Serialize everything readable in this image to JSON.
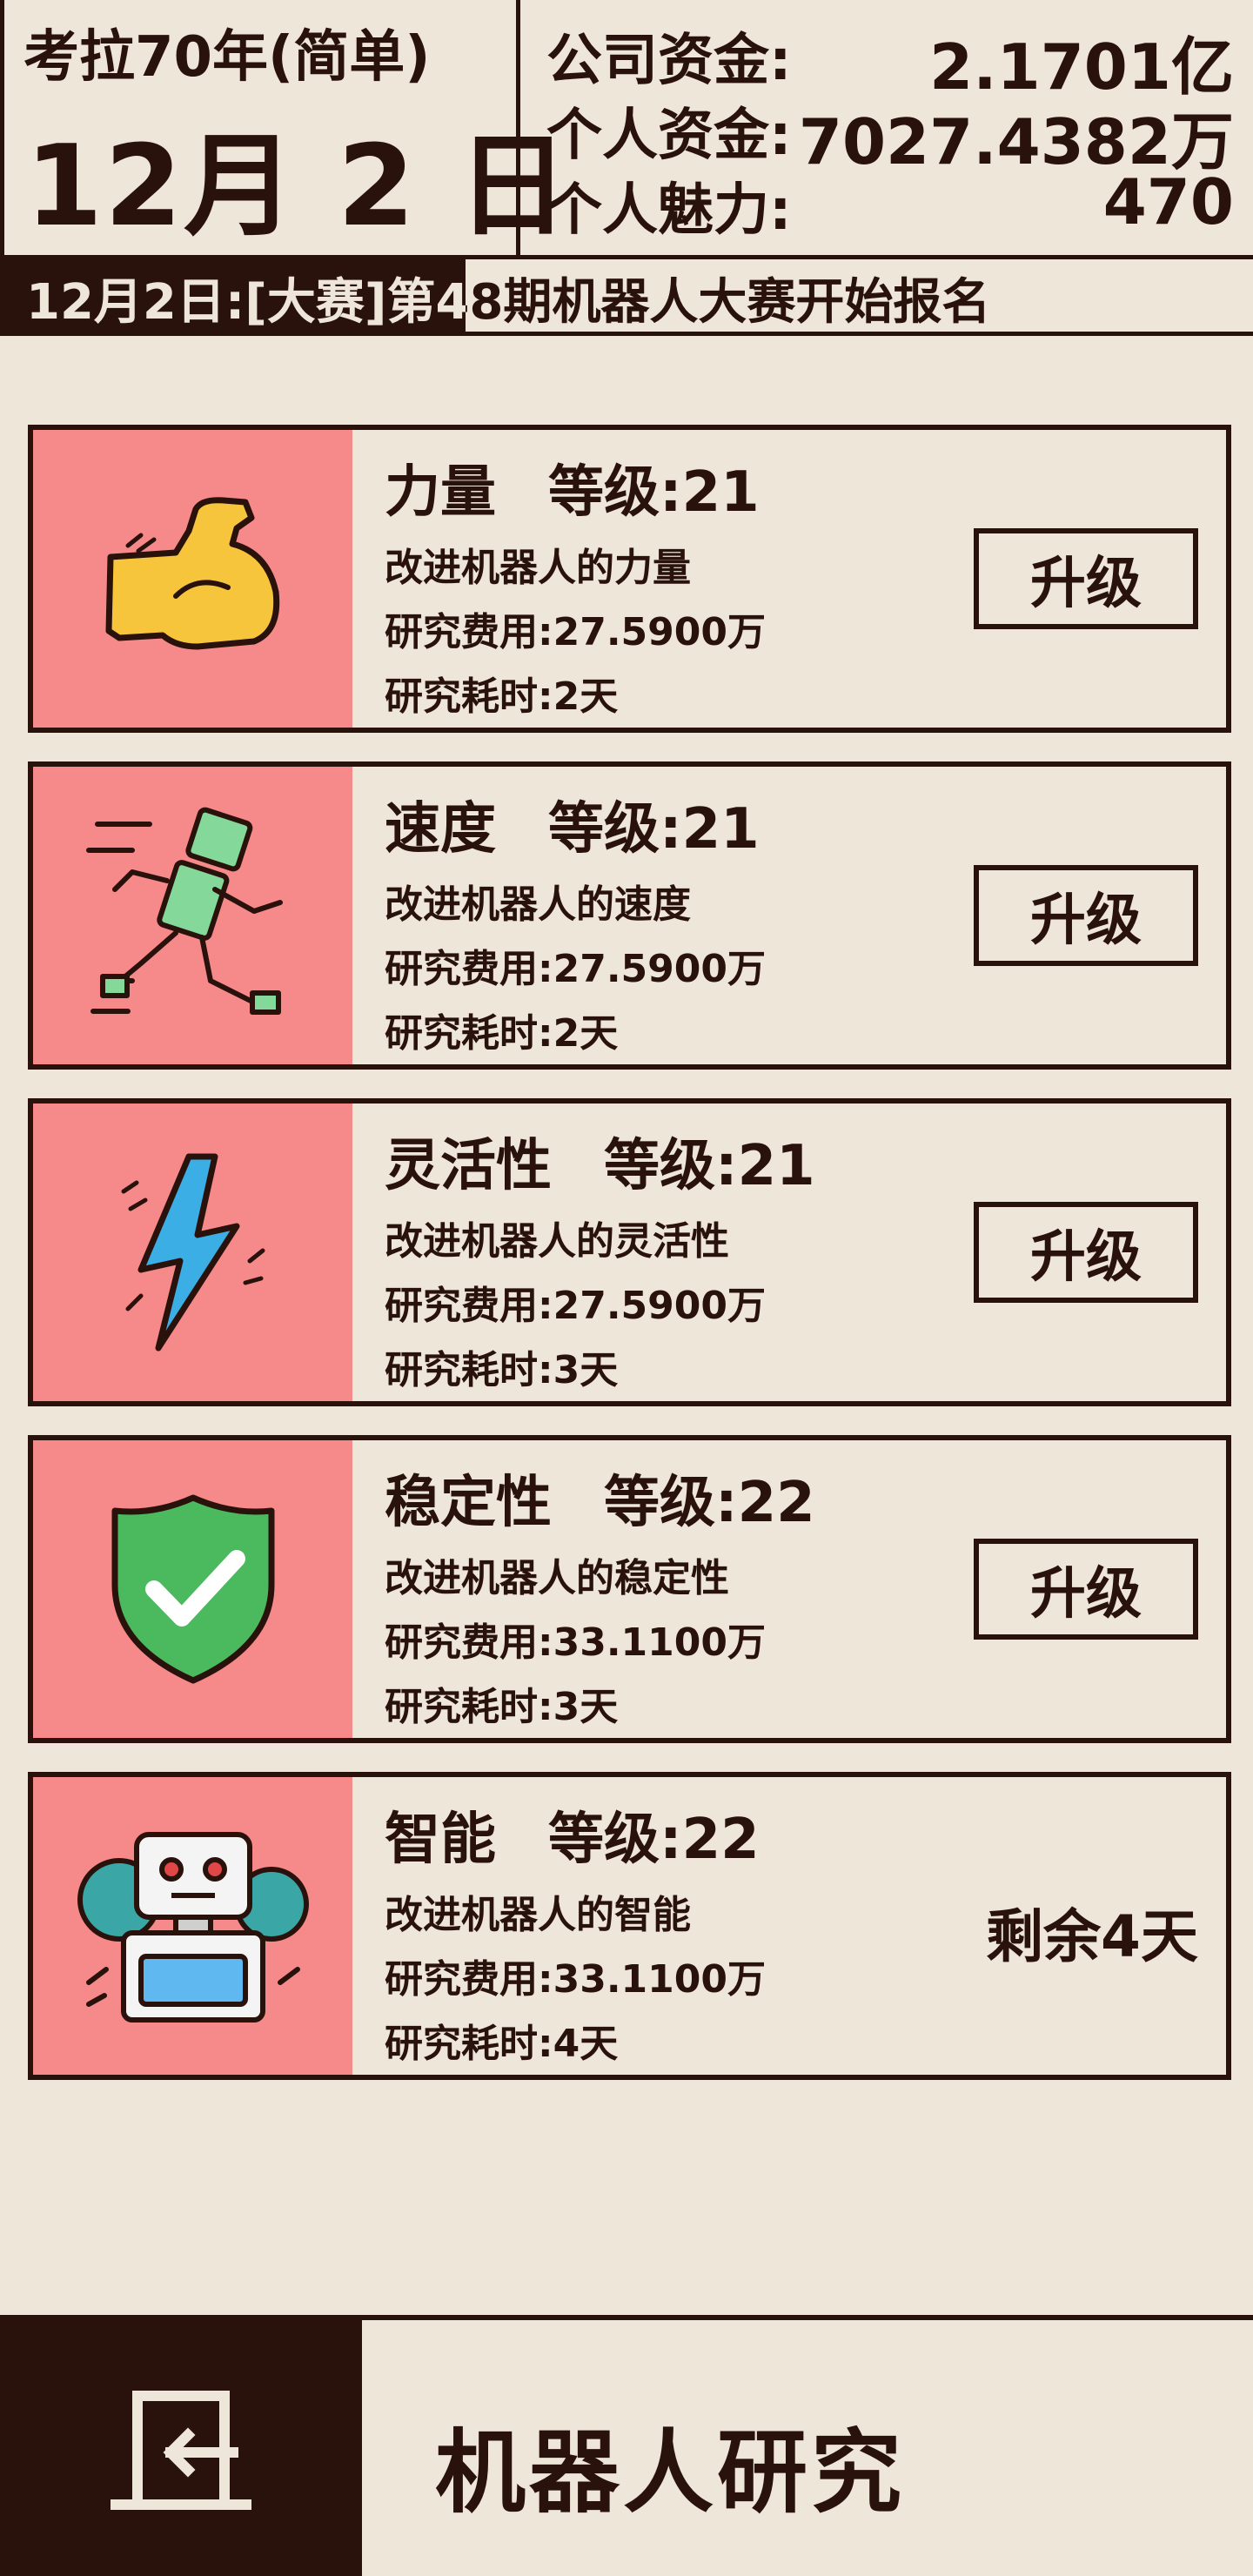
{
  "header": {
    "title": "考拉70年(简单)",
    "date": "12月 2 日",
    "stats": [
      {
        "label": "公司资金:",
        "value": "2.1701亿"
      },
      {
        "label": "个人资金:",
        "value": "7027.4382万"
      },
      {
        "label": "个人魅力:",
        "value": "470"
      }
    ]
  },
  "ticker": {
    "text": "12月2日:[大赛]第48期机器人大赛开始报名"
  },
  "cards": [
    {
      "name": "力量",
      "level": "等级:21",
      "desc": "改进机器人的力量",
      "cost": "研究费用:27.5900万",
      "time": "研究耗时:2天",
      "action": "升级",
      "icon": "flexed-arm-icon"
    },
    {
      "name": "速度",
      "level": "等级:21",
      "desc": "改进机器人的速度",
      "cost": "研究费用:27.5900万",
      "time": "研究耗时:2天",
      "action": "升级",
      "icon": "running-robot-icon"
    },
    {
      "name": "灵活性",
      "level": "等级:21",
      "desc": "改进机器人的灵活性",
      "cost": "研究费用:27.5900万",
      "time": "研究耗时:3天",
      "action": "升级",
      "icon": "lightning-icon"
    },
    {
      "name": "稳定性",
      "level": "等级:22",
      "desc": "改进机器人的稳定性",
      "cost": "研究费用:33.1100万",
      "time": "研究耗时:3天",
      "action": "升级",
      "icon": "shield-check-icon"
    },
    {
      "name": "智能",
      "level": "等级:22",
      "desc": "改进机器人的智能",
      "cost": "研究费用:33.1100万",
      "time": "研究耗时:4天",
      "status": "剩余4天",
      "icon": "robot-gear-icon"
    }
  ],
  "footer": {
    "title": "机器人研究",
    "back_icon": "exit-door-icon"
  },
  "colors": {
    "background": "#ede6d9",
    "ink": "#2a120c",
    "icon_panel": "#f68a8a"
  }
}
